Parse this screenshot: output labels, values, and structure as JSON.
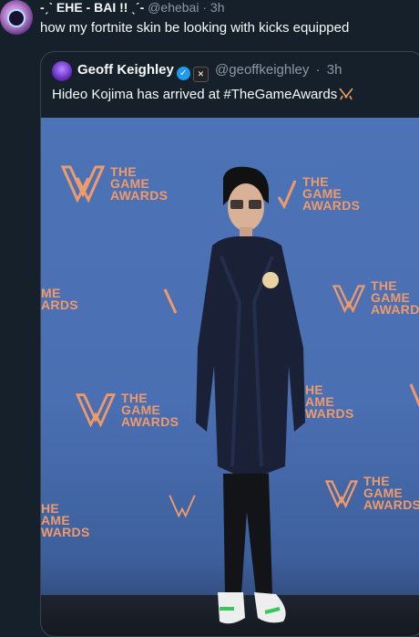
{
  "retweet": {
    "display_name": "-ˏˋ EHE - BAI !! ˎˊ-",
    "handle": "@ehebai",
    "time": "3h",
    "text": "how my fortnite skin be looking with kicks equipped"
  },
  "quoted_tweet": {
    "display_name": "Geoff Keighley",
    "handle": "@geoffkeighley",
    "time": "3h",
    "text": "Hideo Kojima has arrived at #TheGameAwards",
    "verified_icon": "verified-check-icon",
    "affiliate_icon": "affiliate-badge-icon"
  },
  "photo": {
    "backdrop_logo_lines": [
      "THE",
      "GAME",
      "AWARDS"
    ],
    "partial_logo_lines": [
      "HE",
      "AME",
      "WARDS"
    ],
    "partial_logo_lines_2": [
      "ME",
      "ARDS"
    ],
    "colors": {
      "backdrop": "#4a6fb2",
      "logo": "#f09a6a"
    }
  },
  "separator": "·"
}
